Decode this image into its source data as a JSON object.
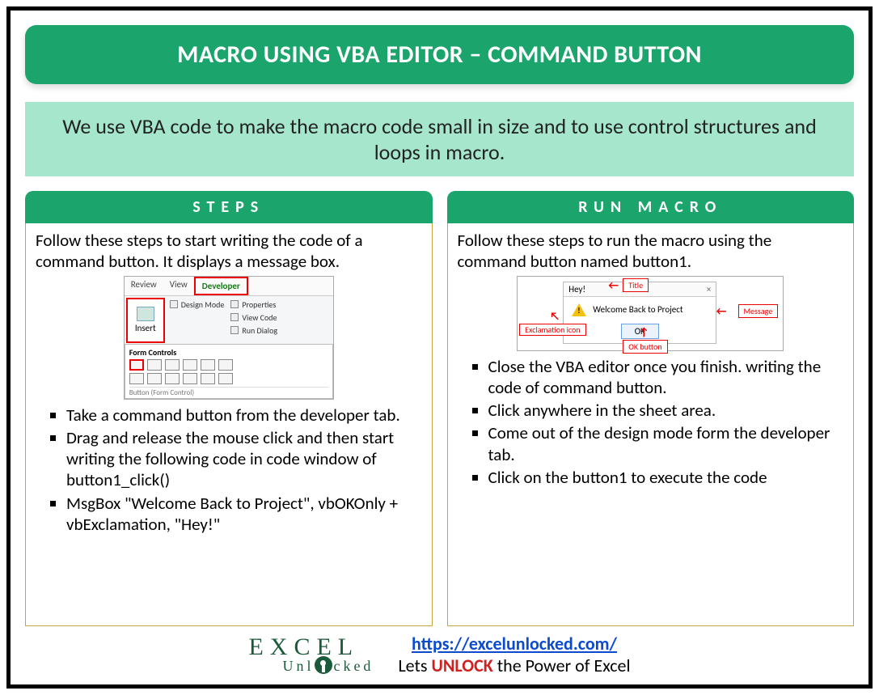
{
  "title": "MACRO USING VBA EDITOR – COMMAND BUTTON",
  "subtitle": "We use VBA code to make the macro code small in size and to use control structures and loops in macro.",
  "left": {
    "header": "STEPS",
    "intro": "Follow these steps to start writing the code of a command button. It displays a message box.",
    "ribbon": {
      "tabs": [
        "Review",
        "View",
        "Developer"
      ],
      "insert": "Insert",
      "side": [
        "Properties",
        "View Code",
        "Run Dialog"
      ],
      "design": "Design Mode",
      "drop_header": "Form Controls",
      "caption": "Button (Form Control)"
    },
    "bullets": [
      "Take a command button from the developer tab.",
      "Drag and release the mouse click and then start writing the following code in code window of button1_click()",
      "MsgBox \"Welcome Back to Project\", vbOKOnly + vbExclamation, \"Hey!\""
    ]
  },
  "right": {
    "header": "RUN MACRO",
    "intro": "Follow these steps to run the macro using the command button named button1.",
    "msgbox": {
      "win_title": "Hey!",
      "message": "Welcome Back to Project",
      "ok": "OK",
      "tags": {
        "title": "Title",
        "message": "Message",
        "icon": "Exclamation icon",
        "ok": "OK button"
      }
    },
    "bullets": [
      "Close the VBA editor once you finish. writing the code of command button.",
      "Click anywhere in the sheet area.",
      "Come out of the design mode form the developer tab.",
      "Click on the button1 to execute the code"
    ]
  },
  "footer": {
    "logo_top": "EXCEL",
    "logo_bot": "Unl   cked",
    "url": "https://excelunlocked.com/",
    "tag_pre": "Lets ",
    "tag_unlock": "UNLOCK",
    "tag_post": " the Power of Excel"
  }
}
